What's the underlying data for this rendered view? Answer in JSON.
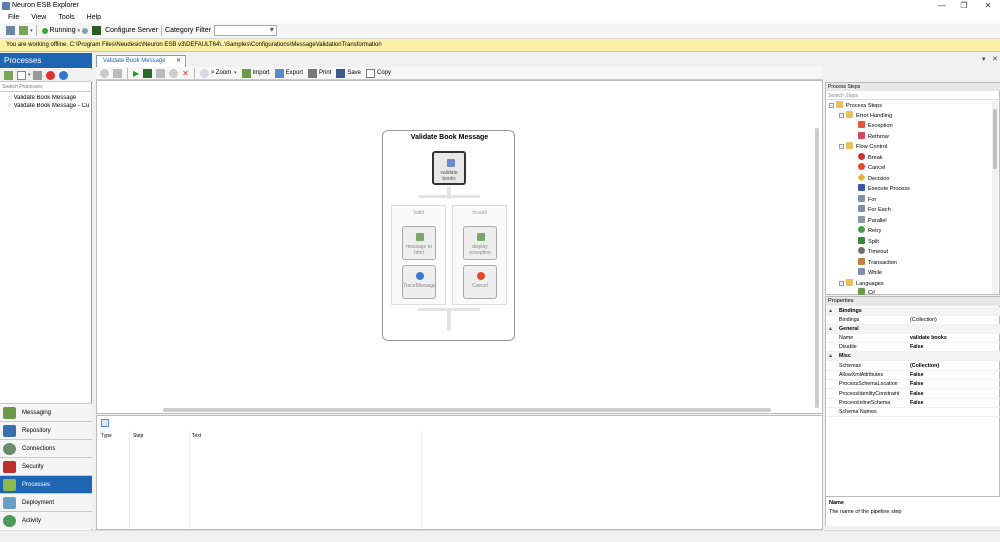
{
  "window": {
    "title": "Neuron ESB Explorer",
    "minimize": "—",
    "maximize": "❐",
    "close": "✕"
  },
  "menu": [
    "File",
    "View",
    "Tools",
    "Help"
  ],
  "toolbar": {
    "status": "Running",
    "configure": "Configure Server",
    "category_filter": "Category Filter",
    "category_value": ""
  },
  "offline_message": "You are working offline.  C:\\Program Files\\Neudesic\\Neuron ESB v3\\DEFAULT64\\..\\Samples\\Configurations\\MessageValidationTransformation",
  "left": {
    "header": "Processes",
    "search_placeholder": "Search Processes",
    "processes": [
      "Validate Book Message",
      "Validate Book Message - Cu"
    ],
    "nav": [
      "Messaging",
      "Repository",
      "Connections",
      "Security",
      "Processes",
      "Deployment",
      "Activity"
    ],
    "active_nav": "Processes"
  },
  "tab": {
    "label": "Validate Book Message",
    "close": "✕"
  },
  "tabstrip": {
    "pin": "▾",
    "close": "✕"
  },
  "design_toolbar": {
    "zoom": "Zoom",
    "import": "Import",
    "export": "Export",
    "print": "Print",
    "save": "Save",
    "copy": "Copy"
  },
  "diagram": {
    "title": "Validate Book Message",
    "first_step": "validate books",
    "branch_valid": "Valid",
    "branch_invalid": "Invalid",
    "valid_steps": [
      "message to html",
      "TraceMessage"
    ],
    "invalid_steps": [
      "display exception",
      "Cancel"
    ]
  },
  "bottom": {
    "columns": [
      "Type",
      "Step",
      "Text"
    ]
  },
  "steps": {
    "header": "Process Steps",
    "search_placeholder": "Search Steps",
    "root": "Process Steps",
    "groups": [
      {
        "name": "Error Handling",
        "items": [
          "Exception",
          "Rethrow"
        ]
      },
      {
        "name": "Flow Control",
        "items": [
          "Break",
          "Cancel",
          "Decision",
          "Execute Process",
          "For",
          "For Each",
          "Parallel",
          "Retry",
          "Split",
          "Timeout",
          "Transaction",
          "While"
        ]
      },
      {
        "name": "Languages",
        "items": [
          "C#"
        ]
      }
    ]
  },
  "properties": {
    "header": "Properties",
    "rows": [
      {
        "cat": "Bindings"
      },
      {
        "name": "Bindings",
        "value": "(Collection)"
      },
      {
        "cat": "General"
      },
      {
        "name": "Name",
        "value": "validate books",
        "bold": true
      },
      {
        "name": "Disable",
        "value": "False",
        "bold": true
      },
      {
        "cat": "Misc"
      },
      {
        "name": "Schemas",
        "value": "(Collection)",
        "bold": true
      },
      {
        "name": "AllowXmlAttributes",
        "value": "False",
        "bold": true
      },
      {
        "name": "ProcessSchemaLocation",
        "value": "False",
        "bold": true
      },
      {
        "name": "ProcessIdentityConstraint",
        "value": "False",
        "bold": true
      },
      {
        "name": "ProcessInlineSchema",
        "value": "False",
        "bold": true
      },
      {
        "name": "Schema Names",
        "value": ""
      }
    ],
    "desc_name": "Name",
    "desc_text": "The name of the pipeline step"
  },
  "colors": {
    "accent": "#1e66b4",
    "offline_bg": "#fbf1a5"
  }
}
